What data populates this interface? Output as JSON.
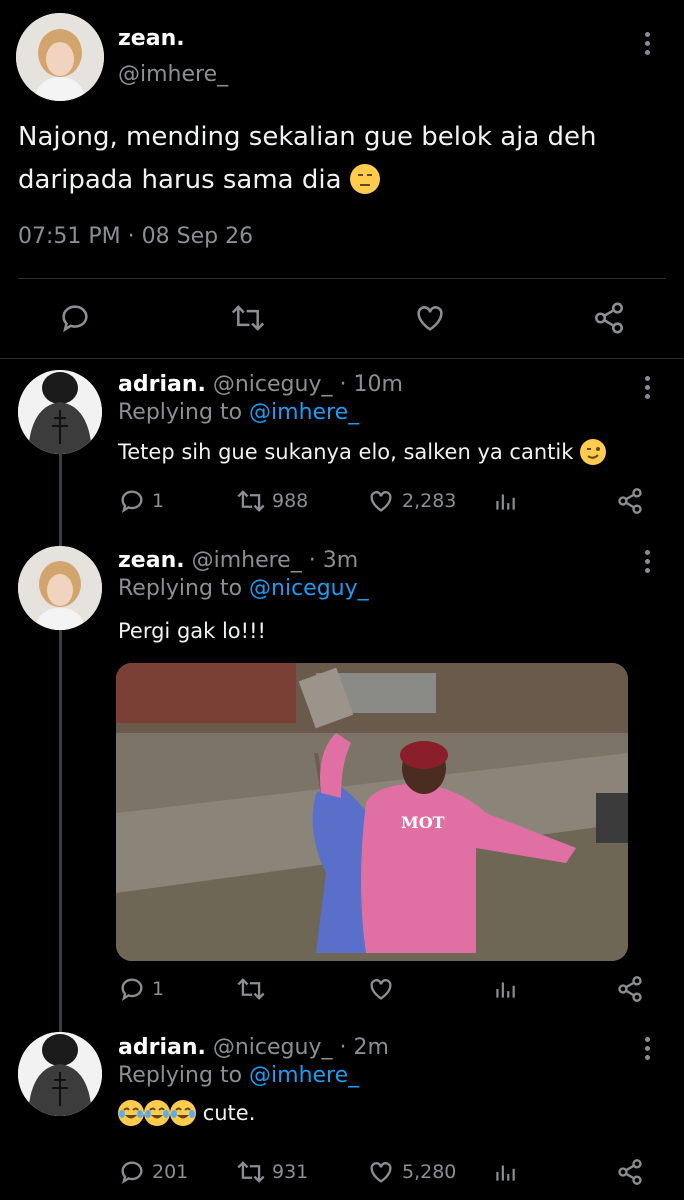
{
  "main_tweet": {
    "display_name": "zean.",
    "handle": "@imhere_",
    "text": "Najong, mending sekalian gue belok aja deh daripada harus sama dia",
    "timestamp": "07:51 PM · 08 Sep 26"
  },
  "replies": [
    {
      "display_name": "adrian.",
      "handle_time": "@niceguy_ · 10m",
      "replying_to_label": "Replying to",
      "replying_to_handle": "@imhere_",
      "text": "Tetep sih gue sukanya elo, salken ya cantik",
      "replies": "1",
      "retweets": "988",
      "likes": "2,283"
    },
    {
      "display_name": "zean.",
      "handle_time": "@imhere_ · 3m",
      "replying_to_label": "Replying to",
      "replying_to_handle": "@niceguy_",
      "text": "Pergi gak lo!!!",
      "replies": "1",
      "retweets": "",
      "likes": ""
    },
    {
      "display_name": "adrian.",
      "handle_time": "@niceguy_ · 2m",
      "replying_to_label": "Replying to",
      "replying_to_handle": "@imhere_",
      "text": "cute.",
      "replies": "201",
      "retweets": "931",
      "likes": "5,280"
    }
  ],
  "icons": {
    "reply": "reply-icon",
    "retweet": "retweet-icon",
    "like": "heart-icon",
    "views": "analytics-icon",
    "share": "share-icon",
    "more": "more-vertical-icon"
  },
  "colors": {
    "background": "#000000",
    "link": "#1d9bf0",
    "muted": "#8b8f94"
  }
}
